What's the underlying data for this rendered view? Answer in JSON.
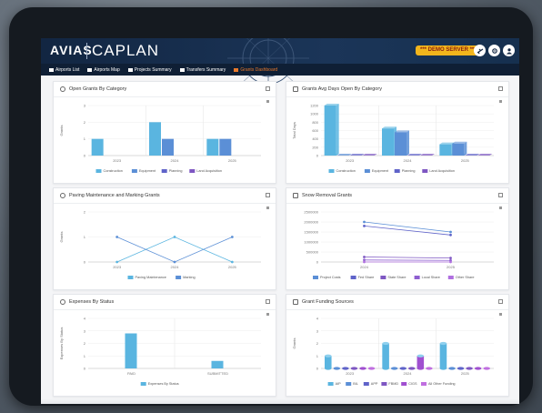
{
  "app": {
    "logo_mark": "AVIAS",
    "logo_text": "CAPLAN",
    "demo_badge": "*** DEMO SERVER ***"
  },
  "topbar": {
    "icons": [
      "plane-icon",
      "settings-icon",
      "user-icon"
    ]
  },
  "nav": [
    {
      "label": "Airports List",
      "icon": "airplane-icon",
      "active": false
    },
    {
      "label": "Airports Map",
      "icon": "map-icon",
      "active": false
    },
    {
      "label": "Projects Summary",
      "icon": "doc-icon",
      "active": false
    },
    {
      "label": "Transfers Summary",
      "icon": "transfer-icon",
      "active": false
    },
    {
      "label": "Grants Dashboard",
      "icon": "chart-icon",
      "active": true
    }
  ],
  "colors": {
    "nav_active": "#e8792b",
    "demo_badge": "#f2b51c",
    "construction": "#5ab5e0",
    "equipment": "#5b8fd6",
    "planning": "#5f63c9",
    "land_acquisition": "#7e57c2"
  },
  "cards": [
    {
      "id": "open-grants",
      "title": "Open Grants By Category",
      "icon": "clock-icon"
    },
    {
      "id": "grants-avg-days",
      "title": "Grants Avg Days Open By Category",
      "icon": "calendar-icon"
    },
    {
      "id": "paving",
      "title": "Paving Maintenance and Marking Grants",
      "icon": "road-icon"
    },
    {
      "id": "snow",
      "title": "Snow Removal Grants",
      "icon": "list-icon"
    },
    {
      "id": "expenses",
      "title": "Expenses By Status",
      "icon": "coins-icon"
    },
    {
      "id": "funding",
      "title": "Grant Funding Sources",
      "icon": "clipboard-icon"
    }
  ],
  "chart_data": [
    {
      "type": "bar",
      "id": "open-grants",
      "title": "Open Grants By Category",
      "categories": [
        "2023",
        "2024",
        "2025"
      ],
      "ylabel": "Grants",
      "ylim": [
        0,
        3
      ],
      "yticks": [
        "0",
        "1",
        "2",
        "3"
      ],
      "series": [
        {
          "name": "Construction",
          "values": [
            1,
            2,
            1
          ]
        },
        {
          "name": "Equipment",
          "values": [
            0,
            1,
            1
          ]
        },
        {
          "name": "Planning",
          "values": [
            0,
            0,
            0
          ]
        },
        {
          "name": "Land Acquisition",
          "values": [
            0,
            0,
            0
          ]
        }
      ]
    },
    {
      "type": "bar",
      "id": "grants-avg-days",
      "title": "Grants Avg Days Open By Category",
      "categories": [
        "2023",
        "2024",
        "2025"
      ],
      "ylabel": "Total Days",
      "ylim": [
        0,
        1200
      ],
      "yticks": [
        "0",
        "200",
        "400",
        "600",
        "800",
        "1000",
        "1200"
      ],
      "series": [
        {
          "name": "Construction",
          "values": [
            1200,
            650,
            270
          ]
        },
        {
          "name": "Equipment",
          "values": [
            0,
            560,
            290
          ]
        },
        {
          "name": "Planning",
          "values": [
            0,
            0,
            0
          ]
        },
        {
          "name": "Land Acquisition",
          "values": [
            0,
            0,
            0
          ]
        }
      ]
    },
    {
      "type": "line",
      "id": "paving",
      "title": "Paving Maintenance and Marking Grants",
      "x": [
        "2023",
        "2024",
        "2025"
      ],
      "ylabel": "Grants",
      "ylim": [
        0,
        2
      ],
      "yticks": [
        "0",
        "1",
        "2"
      ],
      "series": [
        {
          "name": "Paving Maintenance",
          "values": [
            0,
            1,
            0
          ]
        },
        {
          "name": "Marking",
          "values": [
            1,
            0,
            1
          ]
        }
      ]
    },
    {
      "type": "line",
      "id": "snow",
      "title": "Snow Removal Grants",
      "x": [
        "2024",
        "2025"
      ],
      "ylim": [
        0,
        2500000
      ],
      "yticks": [
        "0",
        "500000",
        "1000000",
        "1500000",
        "2000000",
        "2500000"
      ],
      "series": [
        {
          "name": "Project Costs",
          "values": [
            2000000,
            1500000
          ]
        },
        {
          "name": "Fed Share",
          "values": [
            1800000,
            1350000
          ]
        },
        {
          "name": "State Share",
          "values": [
            250000,
            200000
          ]
        },
        {
          "name": "Local Share",
          "values": [
            100000,
            80000
          ]
        },
        {
          "name": "Other Share",
          "values": [
            0,
            0
          ]
        }
      ]
    },
    {
      "type": "bar",
      "id": "expenses",
      "title": "Expenses By Status",
      "categories": [
        "PAID",
        "SUBMITTED"
      ],
      "ylabel": "Expenses By Status",
      "ylim": [
        0,
        4
      ],
      "yticks": [
        "0",
        "1",
        "2",
        "3",
        "4"
      ],
      "series": [
        {
          "name": "Expenses By Status",
          "values": [
            2.8,
            0.6
          ]
        }
      ]
    },
    {
      "type": "bar",
      "id": "funding",
      "title": "Grant Funding Sources",
      "categories": [
        "2023",
        "2024",
        "2025"
      ],
      "ylabel": "Grants",
      "ylim": [
        0,
        4
      ],
      "yticks": [
        "0",
        "1",
        "2",
        "3",
        "4"
      ],
      "series": [
        {
          "name": "AIP",
          "values": [
            1,
            2,
            2
          ]
        },
        {
          "name": "BIL",
          "values": [
            0,
            0,
            0
          ]
        },
        {
          "name": "APP",
          "values": [
            0,
            0,
            0
          ]
        },
        {
          "name": "FBMD",
          "values": [
            0,
            0,
            0
          ]
        },
        {
          "name": "CIGS",
          "values": [
            0,
            1,
            0
          ]
        },
        {
          "name": "All Other Funding",
          "values": [
            0,
            0,
            0
          ]
        }
      ]
    }
  ]
}
